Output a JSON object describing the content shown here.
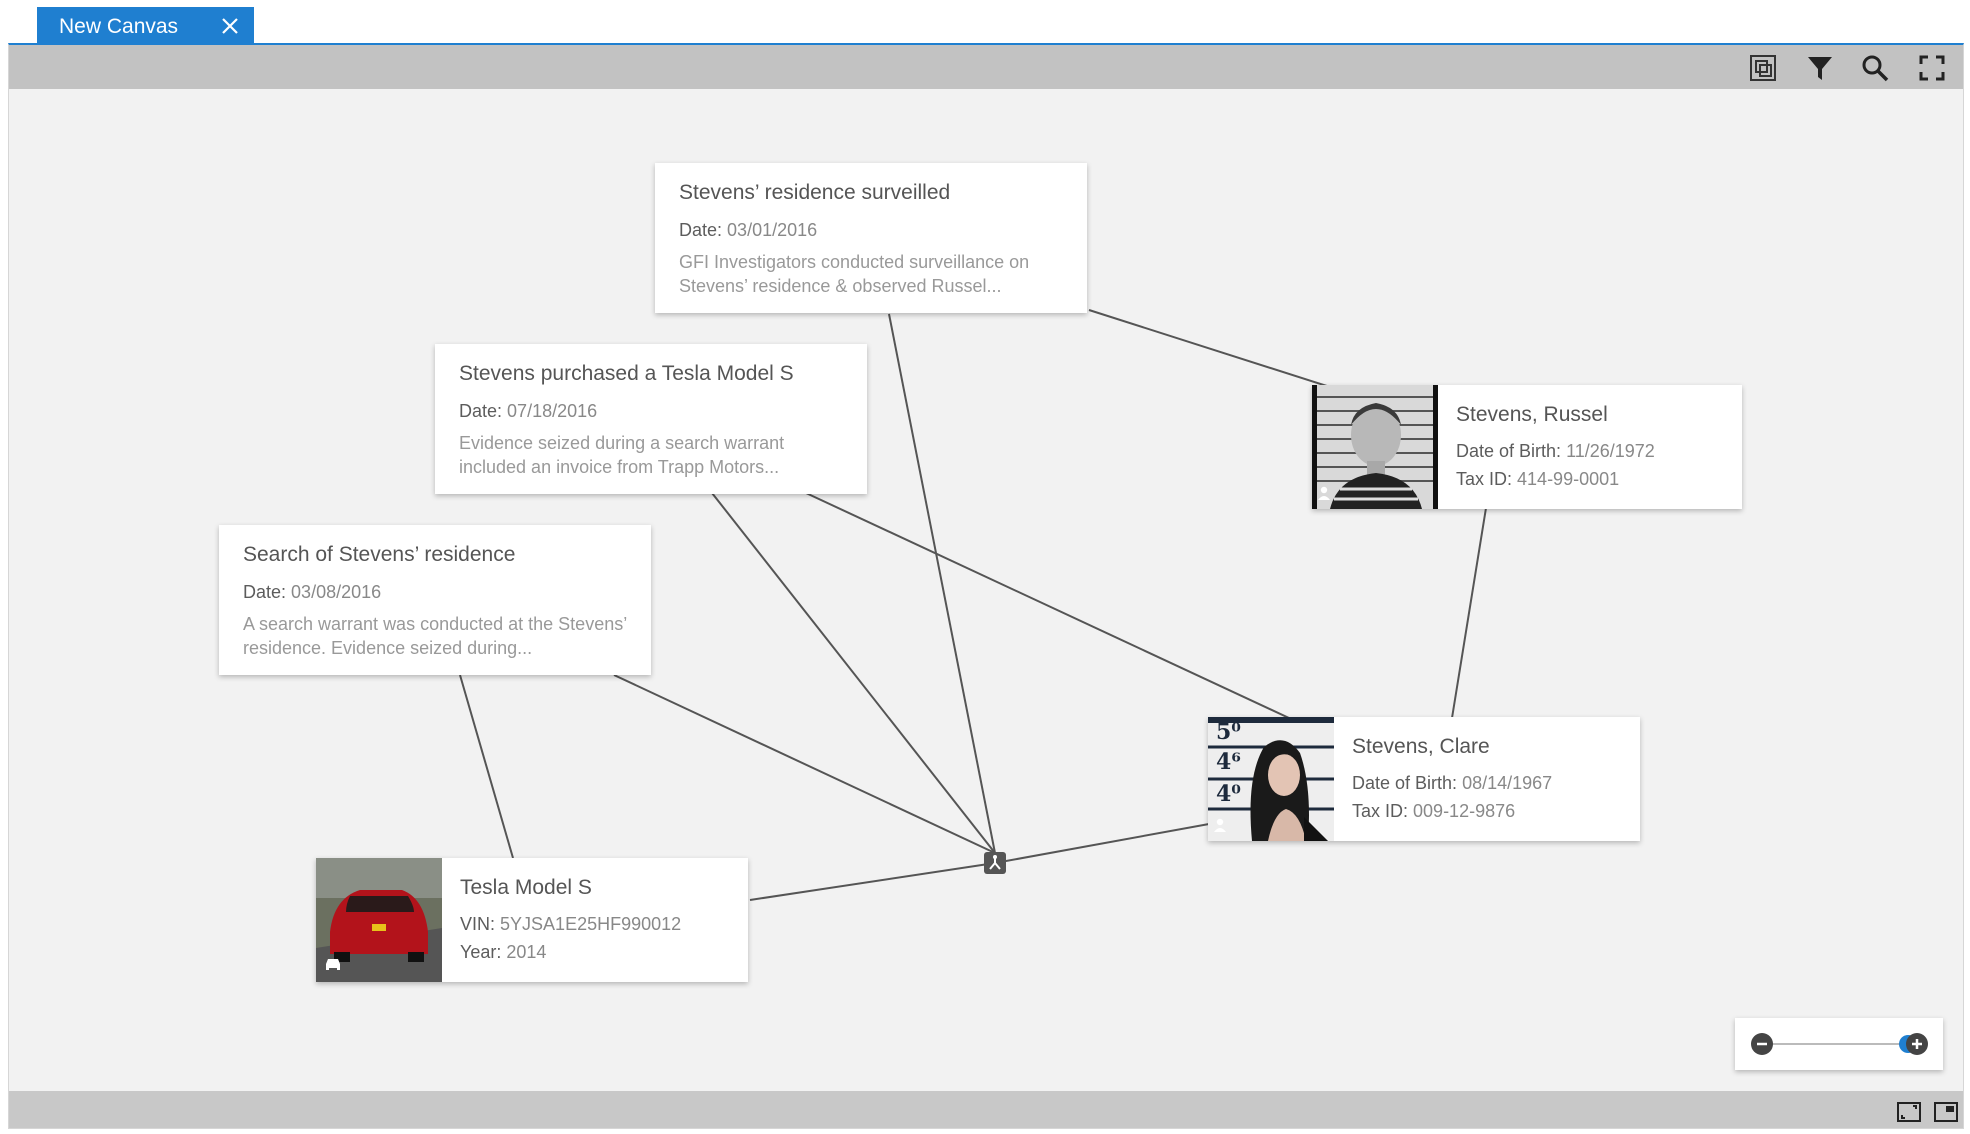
{
  "tab": {
    "label": "New Canvas",
    "close_icon": "close-icon"
  },
  "toolbar": {
    "icons": [
      "layers-icon",
      "filter-icon",
      "search-icon",
      "fullscreen-icon"
    ]
  },
  "events": [
    {
      "title": "Stevens’ residence surveilled",
      "date_label": "Date:",
      "date": "03/01/2016",
      "description": "GFI Investigators conducted surveillance on Stevens’ residence & observed Russel..."
    },
    {
      "title": "Stevens purchased a Tesla Model S",
      "date_label": "Date:",
      "date": "07/18/2016",
      "description": "Evidence seized during a search warrant included an invoice from Trapp Motors..."
    },
    {
      "title": "Search of Stevens’ residence",
      "date_label": "Date:",
      "date": "03/08/2016",
      "description": "A search warrant was conducted at the Stevens’ residence. Evidence seized during..."
    }
  ],
  "entities": [
    {
      "name": "Stevens, Russel",
      "field1_label": "Date of Birth:",
      "field1_value": "11/26/1972",
      "field2_label": "Tax ID:",
      "field2_value": "414-99-0001",
      "type_icon": "person-icon"
    },
    {
      "name": "Stevens, Clare",
      "field1_label": "Date of Birth:",
      "field1_value": "08/14/1967",
      "field2_label": "Tax ID:",
      "field2_value": "009-12-9876",
      "type_icon": "person-icon",
      "height_marks": [
        "5⁰",
        "4⁶",
        "4⁰"
      ]
    },
    {
      "name": "Tesla Model S",
      "field1_label": "VIN:",
      "field1_value": "5YJSA1E25HF990012",
      "field2_label": "Year:",
      "field2_value": "2014",
      "type_icon": "car-icon"
    }
  ],
  "zoom": {
    "level": 0.95
  },
  "statusbar": {
    "icons": [
      "fit-view-icon",
      "minimap-icon"
    ]
  },
  "colors": {
    "accent": "#1f7fd0",
    "toolbar": "#c2c2c2",
    "canvas": "#f2f2f2",
    "link": "#555555"
  }
}
